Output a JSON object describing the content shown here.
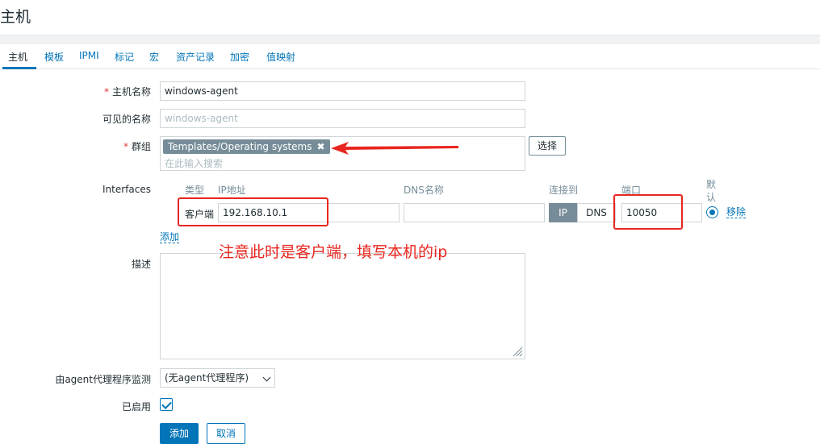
{
  "page": {
    "title": "主机"
  },
  "tabs": [
    {
      "label": "主机"
    },
    {
      "label": "模板"
    },
    {
      "label": "IPMI"
    },
    {
      "label": "标记"
    },
    {
      "label": "宏"
    },
    {
      "label": "资产记录"
    },
    {
      "label": "加密"
    },
    {
      "label": "值映射"
    }
  ],
  "form": {
    "host_name": {
      "required_mark": "*",
      "label": "主机名称",
      "value": "windows-agent"
    },
    "visible_name": {
      "label": "可见的名称",
      "placeholder": "windows-agent"
    },
    "groups": {
      "required_mark": "*",
      "label": "群组",
      "selected": "Templates/Operating systems",
      "placeholder": "在此输入搜索",
      "select_button": "选择"
    },
    "interfaces": {
      "label": "Interfaces",
      "headers": {
        "type": "类型",
        "ip": "IP地址",
        "dns": "DNS名称",
        "connect_to": "连接到",
        "port": "端口",
        "default_line1": "默",
        "default_line2": "认"
      },
      "row": {
        "type": "客户端",
        "ip": "192.168.10.1",
        "dns": "",
        "connect_ip": "IP",
        "connect_dns": "DNS",
        "port": "10050",
        "remove": "移除"
      },
      "add_link": "添加"
    },
    "description": {
      "label": "描述",
      "value": ""
    },
    "proxy": {
      "label": "由agent代理程序监测",
      "selected": "(无agent代理程序)"
    },
    "enabled": {
      "label": "已启用",
      "checked": true
    },
    "buttons": {
      "add": "添加",
      "cancel": "取消"
    }
  },
  "annotation": {
    "text": "注意此时是客户端，填写本机的ip",
    "color": "#e8261f"
  },
  "colors": {
    "accent": "#0275b8",
    "segment_active": "#768d99",
    "annotation_red": "#e8261f",
    "required": "#e33734"
  }
}
